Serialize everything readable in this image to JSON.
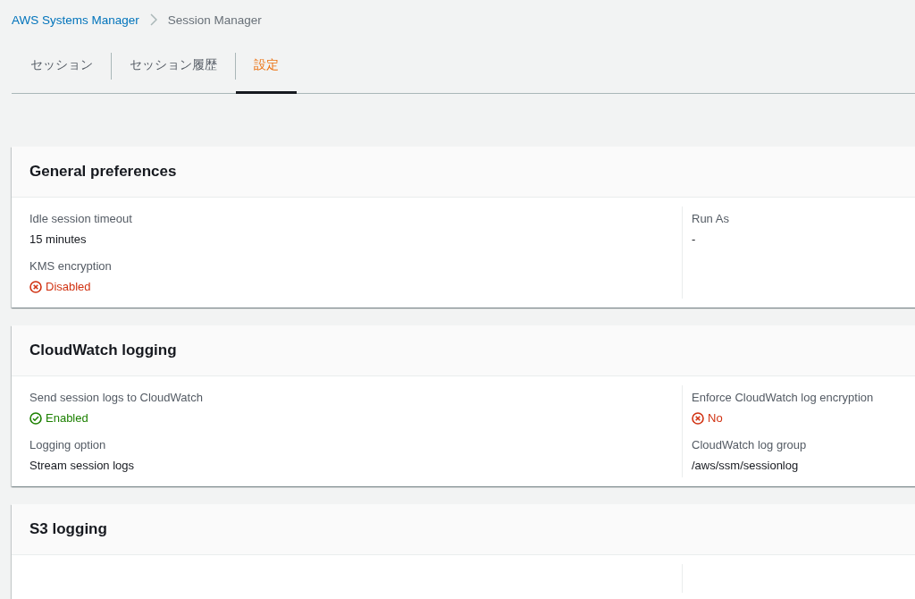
{
  "breadcrumb": [
    {
      "label": "AWS Systems Manager",
      "link": true
    },
    {
      "label": "Session Manager",
      "link": false
    }
  ],
  "tabs": [
    {
      "label": "セッション",
      "selected": false
    },
    {
      "label": "セッション履歴",
      "selected": false
    },
    {
      "label": "設定",
      "selected": true
    }
  ],
  "panels": [
    {
      "title": "General preferences",
      "columns": [
        [
          {
            "label": "Idle session timeout",
            "value": {
              "kind": "text",
              "text": "15 minutes"
            }
          },
          {
            "label": "KMS encryption",
            "value": {
              "kind": "status",
              "ok": false,
              "text": "Disabled"
            }
          }
        ],
        [
          {
            "label": "Run As",
            "value": {
              "kind": "text",
              "text": "-"
            }
          }
        ]
      ]
    },
    {
      "title": "CloudWatch logging",
      "columns": [
        [
          {
            "label": "Send session logs to CloudWatch",
            "value": {
              "kind": "status",
              "ok": true,
              "text": "Enabled"
            }
          },
          {
            "label": "Logging option",
            "value": {
              "kind": "text",
              "text": "Stream session logs"
            }
          }
        ],
        [
          {
            "label": "Enforce CloudWatch log encryption",
            "value": {
              "kind": "status",
              "ok": false,
              "text": "No"
            }
          },
          {
            "label": "CloudWatch log group",
            "value": {
              "kind": "text",
              "text": "/aws/ssm/sessionlog"
            }
          }
        ]
      ]
    },
    {
      "title": "S3 logging"
    }
  ]
}
